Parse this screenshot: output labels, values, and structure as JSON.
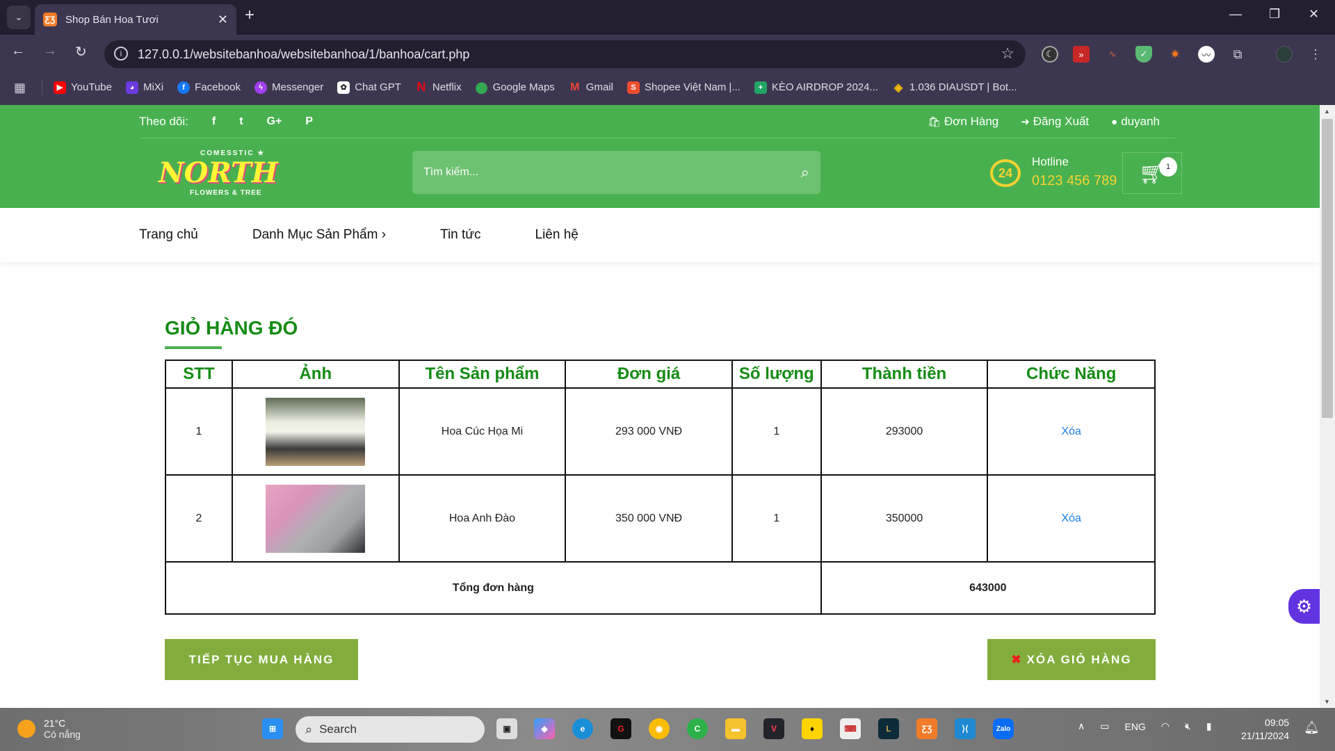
{
  "browser": {
    "tab_title": "Shop Bán Hoa Tươi",
    "tab_favicon": "xampp-icon",
    "url": "127.0.0.1/websitebanhoa/websitebanhoa/1/banhoa/cart.php",
    "bookmarks": [
      {
        "label": "YouTube",
        "icon": "youtube-icon",
        "color": "#ff0000"
      },
      {
        "label": "MiXi",
        "icon": "mixi-icon",
        "color": "#6b3be0"
      },
      {
        "label": "Facebook",
        "icon": "facebook-icon",
        "color": "#1877f2"
      },
      {
        "label": "Messenger",
        "icon": "messenger-icon",
        "color": "#a040f0"
      },
      {
        "label": "Chat GPT",
        "icon": "chatgpt-icon",
        "color": "#ffffff"
      },
      {
        "label": "Netflix",
        "icon": "netflix-icon",
        "color": "#e50914"
      },
      {
        "label": "Google Maps",
        "icon": "google-maps-icon",
        "color": "#34a853"
      },
      {
        "label": "Gmail",
        "icon": "gmail-icon",
        "color": "#ea4335"
      },
      {
        "label": "Shopee Việt Nam |...",
        "icon": "shopee-icon",
        "color": "#ee4d2d"
      },
      {
        "label": "KÈO AIRDROP 2024...",
        "icon": "sheets-icon",
        "color": "#21a464"
      },
      {
        "label": "1.036 DIAUSDT | Bot...",
        "icon": "binance-icon",
        "color": "#f0b90b"
      }
    ]
  },
  "site": {
    "follow_label": "Theo dõi:",
    "social": [
      "f",
      "t",
      "G+",
      "P"
    ],
    "top_links": [
      {
        "label": "Đơn Hàng",
        "icon": "shopping-bag-icon"
      },
      {
        "label": "Đăng Xuất",
        "icon": "sign-out-icon"
      },
      {
        "label": "duyanh",
        "icon": "user-circle-icon"
      }
    ],
    "logo": {
      "top": "COMESSTIC ★",
      "main": "NORTH",
      "sub": "FLOWERS & TREE"
    },
    "search_placeholder": "Tìm kiếm...",
    "hotline_label": "Hotline",
    "hotline_number": "0123 456 789",
    "hotline_badge": "24",
    "cart_count": "1",
    "nav": [
      "Trang chủ",
      "Danh Mục Sản Phẩm ›",
      "Tin tức",
      "Liên hệ"
    ]
  },
  "cart": {
    "title": "GIỎ HÀNG ĐÓ",
    "columns": [
      "STT",
      "Ảnh",
      "Tên Sản phẩm",
      "Đơn giá",
      "Số lượng",
      "Thành tiền",
      "Chức Năng"
    ],
    "rows": [
      {
        "stt": "1",
        "image": "hoa-cuc-hoa-mi-photo",
        "name": "Hoa Cúc Họa Mi",
        "price": "293 000 VNĐ",
        "qty": "1",
        "total": "293000",
        "action": "Xóa"
      },
      {
        "stt": "2",
        "image": "hoa-anh-dao-photo",
        "name": "Hoa Anh Đào",
        "price": "350 000 VNĐ",
        "qty": "1",
        "total": "350000",
        "action": "Xóa"
      }
    ],
    "total_label": "Tổng đơn hàng",
    "total_value": "643000",
    "continue_button": "TIẾP TỤC MUA HÀNG",
    "clear_button": "XÓA GIỎ HÀNG",
    "clear_icon": "✖"
  },
  "taskbar": {
    "weather_temp": "21°C",
    "weather_desc": "Có nắng",
    "search_label": "Search",
    "lang": "ENG",
    "time": "09:05",
    "date": "21/11/2024"
  }
}
